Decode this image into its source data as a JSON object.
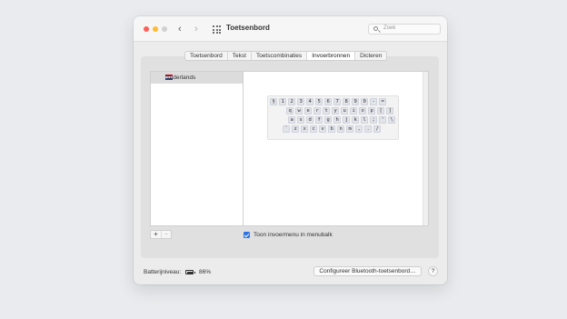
{
  "window": {
    "title": "Toetsenbord",
    "nav_back": "‹",
    "nav_forward": "›",
    "search_placeholder": "Zoek"
  },
  "tabs": [
    {
      "label": "Toetsenbord",
      "active": false
    },
    {
      "label": "Tekst",
      "active": false
    },
    {
      "label": "Toetscombinaties",
      "active": false
    },
    {
      "label": "Invoerbronnen",
      "active": true
    },
    {
      "label": "Dicteren",
      "active": false
    }
  ],
  "input_sources": [
    {
      "label": "Nederlands",
      "flag": "netherlands-flag-icon",
      "selected": true
    }
  ],
  "keyboard_preview": {
    "rows": [
      [
        "§",
        "1",
        "2",
        "3",
        "4",
        "5",
        "6",
        "7",
        "8",
        "9",
        "0",
        "-",
        "="
      ],
      [
        "q",
        "w",
        "e",
        "r",
        "t",
        "y",
        "u",
        "i",
        "o",
        "p",
        "[",
        "]"
      ],
      [
        "a",
        "s",
        "d",
        "f",
        "g",
        "h",
        "j",
        "k",
        "l",
        ";",
        "'",
        "\\"
      ],
      [
        "`",
        "z",
        "x",
        "c",
        "v",
        "b",
        "n",
        "m",
        ",",
        ".",
        "/"
      ]
    ]
  },
  "list_controls": {
    "add": "+",
    "remove": "−"
  },
  "show_input_menu": {
    "label": "Toon invoermenu in menubalk",
    "checked": true
  },
  "footer": {
    "battery_label": "Batterijniveau:",
    "battery_percent": "86%",
    "battery_level": 0.86,
    "configure_button": "Configureer Bluetooth-toetsenbord…",
    "help_button": "?"
  },
  "colors": {
    "accent": "#2a73e8",
    "close": "#fe5f57",
    "minimize": "#febc2e",
    "zoom": "#d0d0d0"
  }
}
